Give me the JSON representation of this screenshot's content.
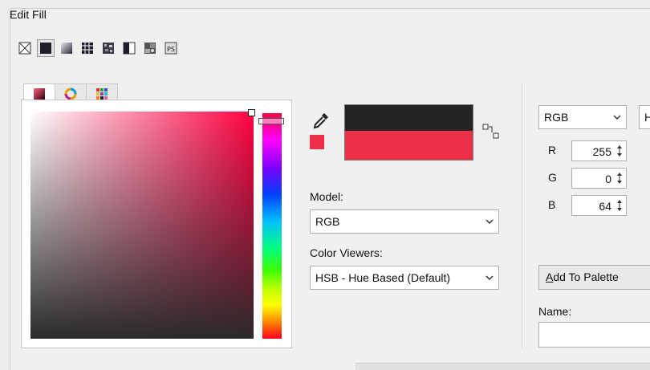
{
  "window": {
    "title": "Edit Fill"
  },
  "toolbar": {
    "buttons": [
      {
        "icon": "no-fill-icon"
      },
      {
        "icon": "uniform-fill-icon",
        "active": true
      },
      {
        "icon": "fountain-fill-icon"
      },
      {
        "icon": "vector-pattern-fill-icon"
      },
      {
        "icon": "bitmap-pattern-fill-icon"
      },
      {
        "icon": "two-color-pattern-fill-icon"
      },
      {
        "icon": "texture-fill-icon"
      },
      {
        "icon": "postscript-fill-icon"
      }
    ],
    "postscript_label": "PS"
  },
  "picker": {
    "tabs": [
      "color-models-tab",
      "color-harmonies-tab",
      "color-palettes-tab"
    ]
  },
  "colors": {
    "current": "#232323",
    "new": "#EE2F4A"
  },
  "model": {
    "label": "Model:",
    "value": "RGB"
  },
  "viewers": {
    "label": "Color Viewers:",
    "value": "HSB - Hue Based (Default)"
  },
  "right": {
    "mode_select": "RGB",
    "second_select": "H",
    "r": {
      "label": "R",
      "value": "255"
    },
    "g": {
      "label": "G",
      "value": "0"
    },
    "b": {
      "label": "B",
      "value": "64"
    },
    "add_button": {
      "mnemonic": "A",
      "rest": "dd To Palette"
    },
    "name_label": "Name:"
  }
}
